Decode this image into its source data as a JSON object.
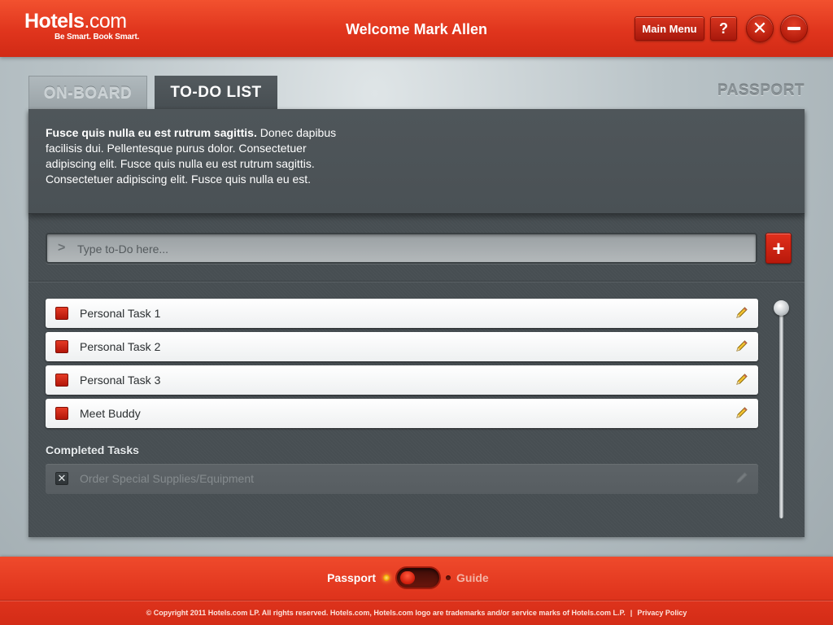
{
  "header": {
    "logo_name": "Hotels",
    "logo_dotcom": ".com",
    "logo_tagline": "Be Smart. Book Smart.",
    "welcome": "Welcome Mark Allen",
    "main_menu_label": "Main Menu",
    "help_label": "?",
    "close_label": "✕"
  },
  "tabs": [
    {
      "label": "ON-BOARD",
      "active": false
    },
    {
      "label": "TO-DO LIST",
      "active": true
    }
  ],
  "passport_label": "PASSPORT",
  "intro": {
    "bold": "Fusce quis nulla eu est rutrum sagittis.",
    "text": " Donec dapibus facilisis dui. Pellentesque purus dolor. Consectetuer adipiscing elit. Fusce quis nulla eu est rutrum sagittis. Consectetuer adipiscing elit. Fusce quis nulla eu est."
  },
  "todo_input": {
    "placeholder": "Type to-Do here...",
    "value": "",
    "prompt_icon": ">",
    "add_label": "+"
  },
  "tasks": [
    {
      "label": "Personal Task 1",
      "done": false
    },
    {
      "label": "Personal Task 2",
      "done": false
    },
    {
      "label": "Personal Task 3",
      "done": false
    },
    {
      "label": "Meet Buddy",
      "done": false
    }
  ],
  "completed": {
    "heading": "Completed Tasks",
    "items": [
      {
        "label": "Order Special Supplies/Equipment",
        "done": true,
        "check_mark": "✕"
      }
    ]
  },
  "footer": {
    "switch_left": "Passport",
    "switch_right": "Guide",
    "switch_state": "Passport",
    "copyright": "© Copyright 2011 Hotels.com LP.  All rights reserved. Hotels.com, Hotels.com logo are trademarks and/or service marks of Hotels.com L.P.",
    "separator": "|",
    "privacy": "Privacy Policy"
  },
  "colors": {
    "brand_red": "#e0351d",
    "panel_dark": "#474e52",
    "task_checkbox": "#c8200f"
  },
  "icons": {
    "edit": "pencil-icon",
    "add": "plus-icon",
    "close": "close-icon",
    "minimize": "minus-icon",
    "help": "question-icon"
  }
}
